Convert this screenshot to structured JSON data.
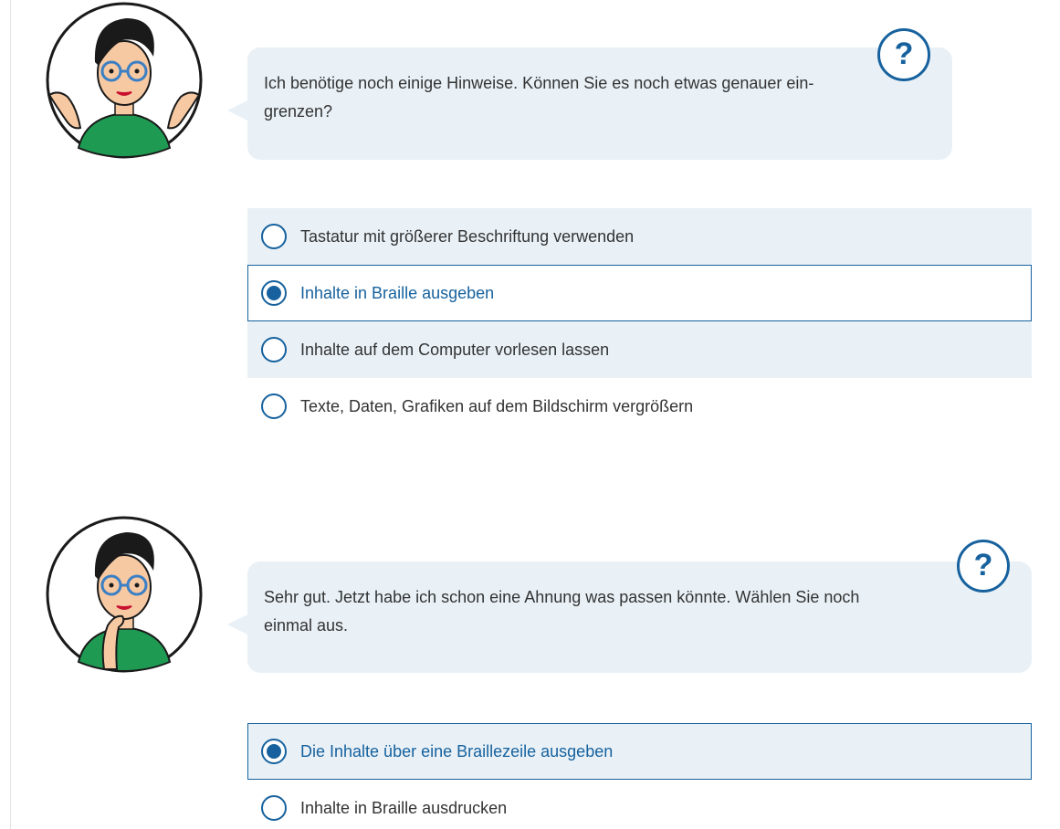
{
  "step1": {
    "assistant_message": "Ich benötige noch einige Hinweise. Können Sie es noch etwas genauer ein-grenzen?",
    "message_line1": "Ich benötige noch einige Hinweise. Können Sie es noch etwas genauer ein-",
    "message_line2": "grenzen?",
    "help_label": "?",
    "options": [
      {
        "label": "Tastatur mit größerer Beschriftung verwenden",
        "selected": false
      },
      {
        "label": "Inhalte in Braille ausgeben",
        "selected": true
      },
      {
        "label": "Inhalte auf dem Computer vorlesen lassen",
        "selected": false
      },
      {
        "label": "Texte, Daten, Grafiken auf dem Bildschirm vergrößern",
        "selected": false
      }
    ]
  },
  "step2": {
    "message_line1": "Sehr gut. Jetzt habe ich schon eine Ahnung was passen könnte. Wählen Sie noch",
    "message_line2": "einmal aus.",
    "help_label": "?",
    "options": [
      {
        "label": "Die Inhalte über eine Braillezeile ausgeben",
        "selected": true
      },
      {
        "label": "Inhalte in Braille ausdrucken",
        "selected": false
      }
    ]
  },
  "colors": {
    "accent": "#17629e",
    "bubble_bg": "#e9f1f7",
    "text": "#333333",
    "avatar_shirt": "#1e9a52",
    "avatar_glasses": "#3b7fc4"
  },
  "icons": {
    "help": "question-circle-icon",
    "radio_selected": "radio-checked-icon",
    "radio_unselected": "radio-unchecked-icon"
  }
}
